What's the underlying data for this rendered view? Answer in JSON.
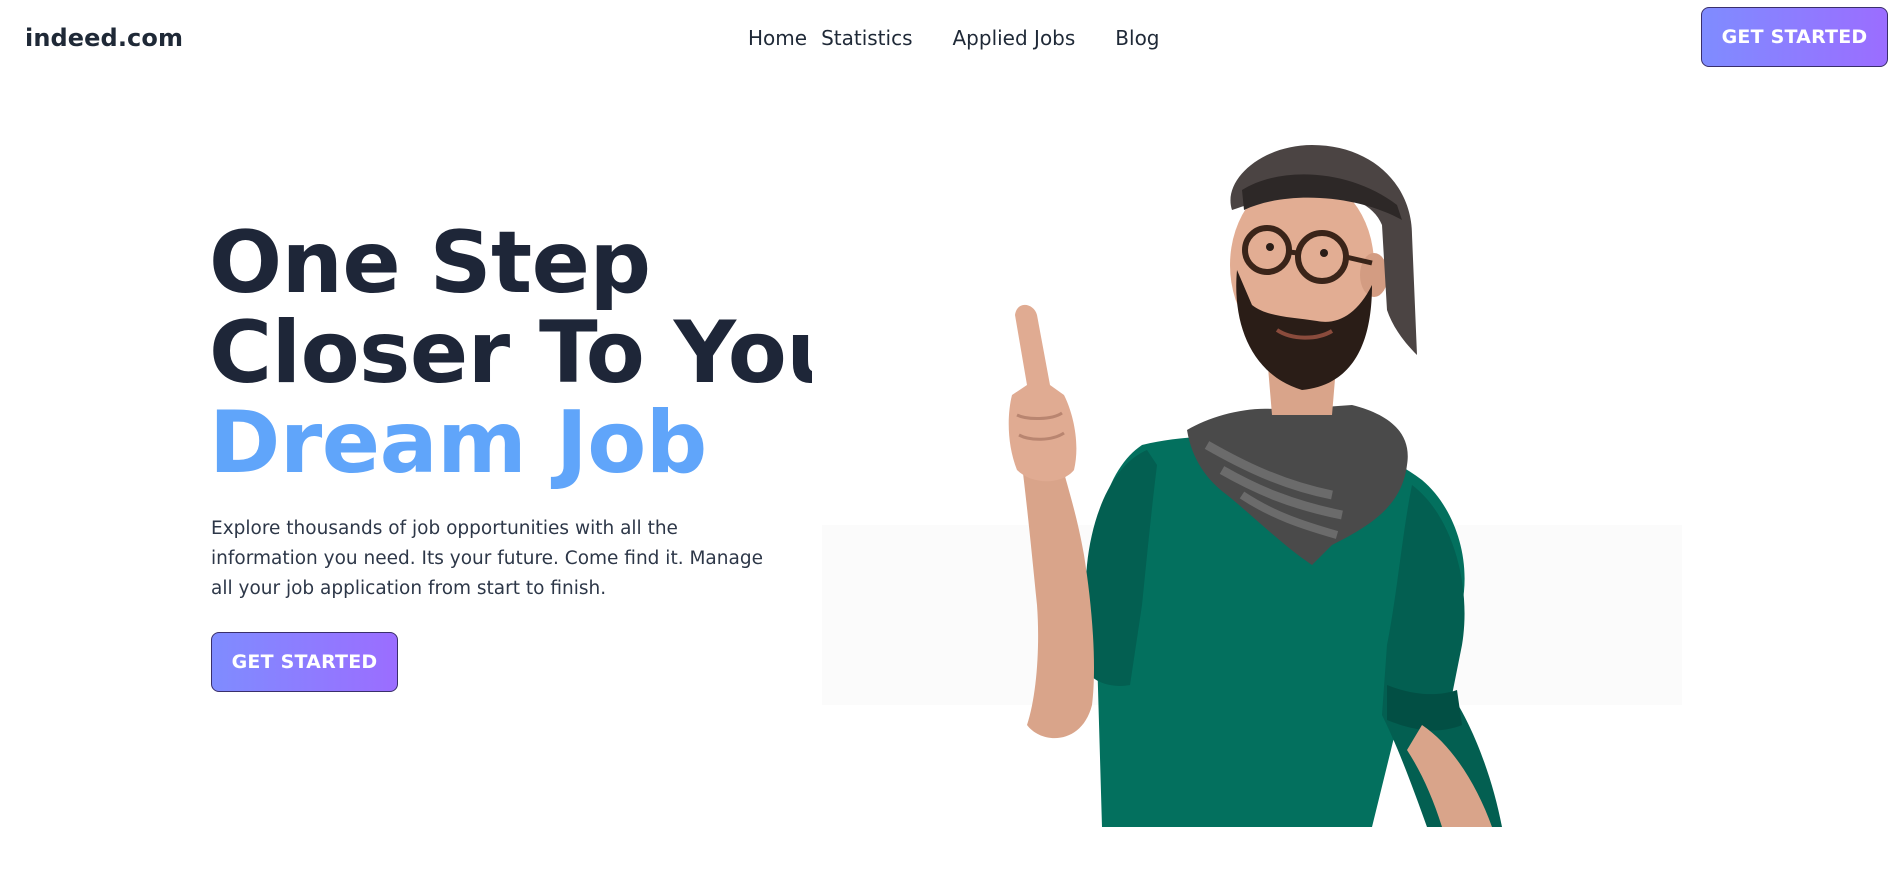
{
  "brand": {
    "logo_text": "indeed.com"
  },
  "nav": {
    "items": [
      {
        "label": "Home"
      },
      {
        "label": "Statistics"
      },
      {
        "label": "Applied Jobs"
      },
      {
        "label": "Blog"
      }
    ],
    "cta_label": "GET STARTED"
  },
  "hero": {
    "title_line1": "One Step",
    "title_line2": "Closer To Your",
    "title_accent": "Dream Job",
    "description": "Explore thousands of job opportunities with all the information you need. Its your future. Come find it. Manage all your job application from start to finish.",
    "cta_label": "GET STARTED"
  },
  "colors": {
    "title": "#1e2638",
    "accent": "#60a5fa",
    "button_gradient_start": "#7f8cff",
    "button_gradient_end": "#9b6dff",
    "shirt": "#03705e",
    "scarf": "#4a4a4a"
  }
}
